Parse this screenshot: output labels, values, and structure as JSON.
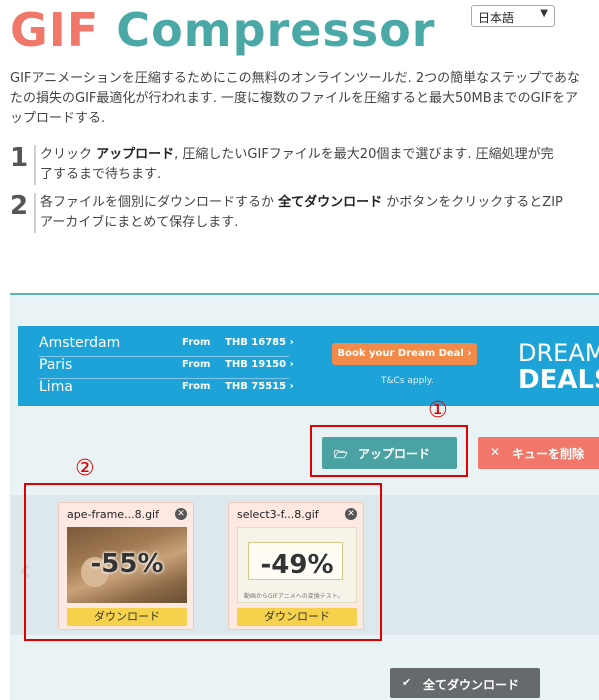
{
  "header": {
    "title_part1": "GIF",
    "title_part2": " Compressor",
    "language": "日本語"
  },
  "intro": "GIFアニメーションを圧縮するためにこの無料のオンラインツールだ. 2つの簡単なステップであなたの損失のGIF最適化が行われます. 一度に複数のファイルを圧縮すると最大50MBまでのGIFをアップロードする.",
  "steps": [
    {
      "num": "1",
      "pre": "クリック ",
      "bold": "アップロード",
      "post": ", 圧縮したいGIFファイルを最大20個まで選びます. 圧縮処理が完了するまで待ちます."
    },
    {
      "num": "2",
      "pre": "各ファイルを個別にダウンロードするか ",
      "bold": "全てダウンロード",
      "post": " かボタンをクリックするとZIPアーカイブにまとめて保存します."
    }
  ],
  "ad": {
    "rows": [
      {
        "city": "Amsterdam",
        "from": "From",
        "price": "THB 16785 ›"
      },
      {
        "city": "Paris",
        "from": "From",
        "price": "THB 19150 ›"
      },
      {
        "city": "Lima",
        "from": "From",
        "price": "THB 75515 ›"
      }
    ],
    "book": "Book your Dream Deal ›",
    "tcs": "T&Cs apply.",
    "dream": "DREAM",
    "deals": "DEALS"
  },
  "toolbar": {
    "upload_label": "アップロード",
    "clear_label": "キューを削除",
    "download_all_label": "全てダウンロード"
  },
  "annotations": {
    "mark1": "①",
    "mark2": "②"
  },
  "files": [
    {
      "name": "ape-frame...8.gif",
      "percent": "-55%",
      "download": "ダウンロード"
    },
    {
      "name": "select3-f...8.gif",
      "percent": "-49%",
      "download": "ダウンロード"
    }
  ],
  "thumb2": {
    "caption": "動画からGIFアニメへの変換テスト。"
  },
  "colors": {
    "accent_teal": "#4aa3a2",
    "accent_red": "#f0776a",
    "annotation_red": "#e00000",
    "download_yellow": "#f6d14c"
  }
}
